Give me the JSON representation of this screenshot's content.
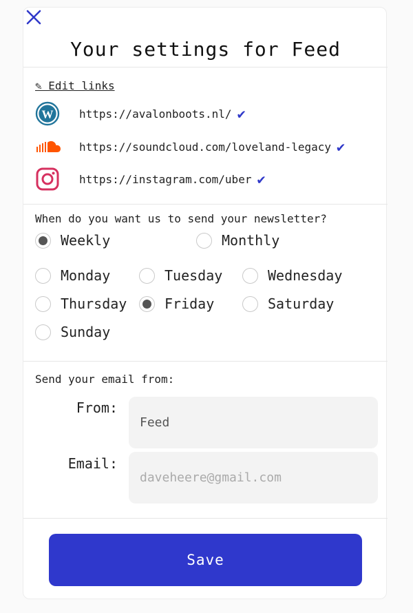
{
  "header": {
    "title": "Your settings for Feed",
    "close_icon": "close-icon"
  },
  "links": {
    "edit_label": "✎ Edit links",
    "items": [
      {
        "icon": "wordpress-icon",
        "url": "https://avalonboots.nl/",
        "verified": "✔"
      },
      {
        "icon": "soundcloud-icon",
        "url": "https://soundcloud.com/loveland-legacy",
        "verified": "✔"
      },
      {
        "icon": "instagram-icon",
        "url": "https://instagram.com/uber",
        "verified": "✔"
      }
    ]
  },
  "schedule": {
    "question": "When do you want us to send your newsletter?",
    "frequency": {
      "options": [
        "Weekly",
        "Monthly"
      ],
      "selected": "Weekly"
    },
    "days": {
      "options": [
        "Monday",
        "Tuesday",
        "Wednesday",
        "Thursday",
        "Friday",
        "Saturday",
        "Sunday"
      ],
      "selected": "Friday"
    }
  },
  "sender": {
    "heading": "Send your email from:",
    "from_label": "From:",
    "from_value": "Feed",
    "email_label": "Email:",
    "email_placeholder": "daveheere@gmail.com"
  },
  "actions": {
    "save_label": "Save"
  },
  "colors": {
    "accent": "#2f38cc",
    "check": "#2f38c9",
    "wordpress": "#21759b",
    "soundcloud": "#ff5500",
    "instagram": "#d6305f"
  }
}
